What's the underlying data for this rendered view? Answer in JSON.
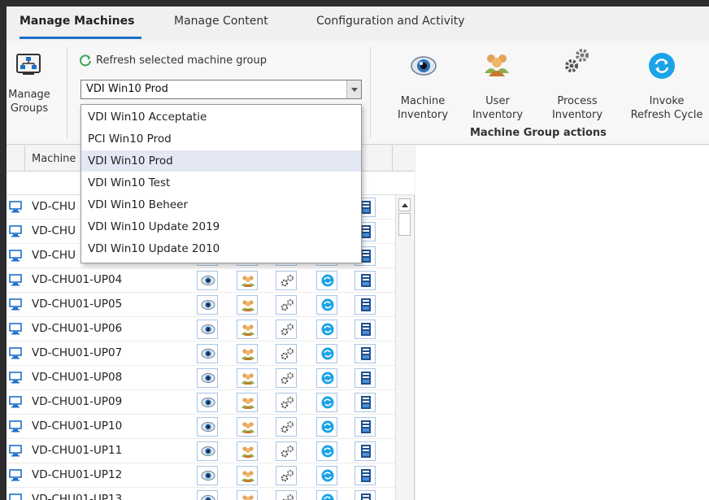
{
  "tabs": [
    {
      "label": "Manage Machines",
      "active": true
    },
    {
      "label": "Manage Content",
      "active": false
    },
    {
      "label": "Configuration and Activity",
      "active": false
    }
  ],
  "ribbon": {
    "manage_groups_line1": "Manage",
    "manage_groups_line2": "Groups",
    "refresh_label": "Refresh selected machine group",
    "selected_group": "VDI Win10 Prod",
    "actions": [
      {
        "line1": "Machine",
        "line2": "Inventory",
        "icon": "eye-icon"
      },
      {
        "line1": "User",
        "line2": "Inventory",
        "icon": "users-icon"
      },
      {
        "line1": "Process",
        "line2": "Inventory",
        "icon": "gears-icon"
      },
      {
        "line1": "Invoke",
        "line2": "Refresh Cycle",
        "icon": "refresh-cycle-icon"
      }
    ],
    "group_actions_label": "Machine Group actions"
  },
  "dropdown": {
    "options": [
      "VDI Win10 Acceptatie",
      "PCI Win10 Prod",
      "VDI Win10 Prod",
      "VDI Win10 Test",
      "VDI Win10 Beheer",
      "VDI Win10 Update 2019",
      "VDI Win10 Update 2010"
    ],
    "selected": "VDI Win10 Prod"
  },
  "grid": {
    "column_machine": "Machine",
    "rows": [
      "VD-CHU",
      "VD-CHU",
      "VD-CHU",
      "VD-CHU01-UP04",
      "VD-CHU01-UP05",
      "VD-CHU01-UP06",
      "VD-CHU01-UP07",
      "VD-CHU01-UP08",
      "VD-CHU01-UP09",
      "VD-CHU01-UP10",
      "VD-CHU01-UP11",
      "VD-CHU01-UP12",
      "VD-CHU01-UP13"
    ]
  },
  "colors": {
    "accent": "#1e6fc8",
    "refresh": "#1aa3e8",
    "selection": "#e3e8f4"
  }
}
